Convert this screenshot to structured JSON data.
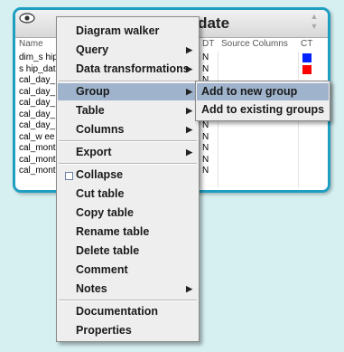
{
  "table_card": {
    "title": "dim_ship_date",
    "title_visible": "dim_ship_date",
    "columns_header": {
      "name": "Name",
      "dt": "DT",
      "source": "Source Columns",
      "ct": "CT"
    },
    "rows": [
      {
        "name": "dim_s hip",
        "dt": "N",
        "ct_color": "#0022ff"
      },
      {
        "name": "s hip_dat",
        "dt": "N",
        "ct_color": "#ff0000"
      },
      {
        "name": "cal_day_",
        "dt": "N",
        "ct_color": ""
      },
      {
        "name": "cal_day_",
        "dt": "N",
        "ct_color": ""
      },
      {
        "name": "cal_day_",
        "dt": "N",
        "ct_color": ""
      },
      {
        "name": "cal_day_",
        "dt": "N",
        "ct_color": ""
      },
      {
        "name": "cal_day_",
        "dt": "N",
        "ct_color": ""
      },
      {
        "name": "cal_w ee",
        "dt": "N",
        "ct_color": ""
      },
      {
        "name": "cal_mont",
        "dt": "N",
        "ct_color": ""
      },
      {
        "name": "cal_mont",
        "dt": "N",
        "ct_color": ""
      },
      {
        "name": "cal_mont",
        "dt": "N",
        "ct_color": ""
      }
    ],
    "icons": {
      "visibility": "eye-icon",
      "scroll_up": "scroll-up-icon",
      "scroll_down": "scroll-down-icon"
    }
  },
  "context_menu": {
    "items": [
      {
        "label": "Diagram walker",
        "submenu": false
      },
      {
        "label": "Query",
        "submenu": true
      },
      {
        "label": "Data transformations",
        "submenu": true
      },
      {
        "label": "Group",
        "submenu": true,
        "highlighted": true
      },
      {
        "label": "Table",
        "submenu": true
      },
      {
        "label": "Columns",
        "submenu": true
      },
      {
        "label": "Export",
        "submenu": true
      },
      {
        "label": "Collapse",
        "submenu": false,
        "checkbox": true
      },
      {
        "label": "Cut table",
        "submenu": false
      },
      {
        "label": "Copy table",
        "submenu": false
      },
      {
        "label": "Rename table",
        "submenu": false
      },
      {
        "label": "Delete table",
        "submenu": false
      },
      {
        "label": "Comment",
        "submenu": false
      },
      {
        "label": "Notes",
        "submenu": true
      },
      {
        "label": "Documentation",
        "submenu": false
      },
      {
        "label": "Properties",
        "submenu": false
      }
    ]
  },
  "group_submenu": {
    "items": [
      {
        "label": "Add to new group",
        "highlighted": true
      },
      {
        "label": "Add to existing groups",
        "highlighted": false
      }
    ]
  },
  "colors": {
    "background": "#d6f0f2",
    "card_border": "#1e9fc2",
    "menu_bg": "#eeeeee",
    "highlight": "#9fb3cc"
  }
}
